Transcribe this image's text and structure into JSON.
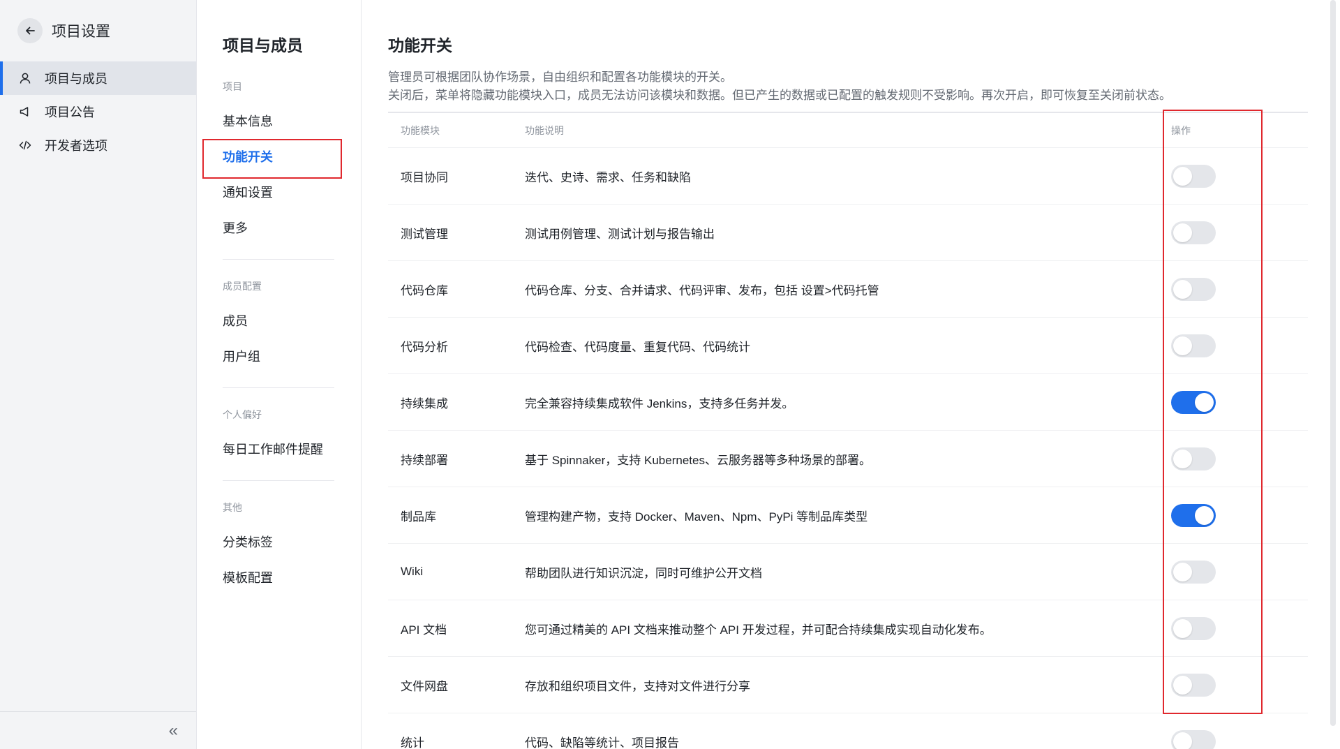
{
  "sidebar": {
    "title": "项目设置",
    "items": [
      {
        "label": "项目与成员",
        "icon": "user-icon",
        "active": true
      },
      {
        "label": "项目公告",
        "icon": "megaphone-icon",
        "active": false
      },
      {
        "label": "开发者选项",
        "icon": "code-icon",
        "active": false
      }
    ],
    "collapse_label": "«"
  },
  "subnav": {
    "title": "项目与成员",
    "groups": [
      {
        "label": "项目",
        "items": [
          "基本信息",
          "功能开关",
          "通知设置",
          "更多"
        ]
      },
      {
        "label": "成员配置",
        "items": [
          "成员",
          "用户组"
        ]
      },
      {
        "label": "个人偏好",
        "items": [
          "每日工作邮件提醒"
        ]
      },
      {
        "label": "其他",
        "items": [
          "分类标签",
          "模板配置"
        ]
      }
    ],
    "active_item": "功能开关"
  },
  "main": {
    "title": "功能开关",
    "desc_lines": [
      "管理员可根据团队协作场景，自由组织和配置各功能模块的开关。",
      "关闭后，菜单将隐藏功能模块入口，成员无法访问该模块和数据。但已产生的数据或已配置的触发规则不受影响。再次开启，即可恢复至关闭前状态。"
    ],
    "table": {
      "headers": {
        "module": "功能模块",
        "desc": "功能说明",
        "op": "操作"
      },
      "rows": [
        {
          "module": "项目协同",
          "desc": "迭代、史诗、需求、任务和缺陷",
          "on": false
        },
        {
          "module": "测试管理",
          "desc": "测试用例管理、测试计划与报告输出",
          "on": false
        },
        {
          "module": "代码仓库",
          "desc": "代码仓库、分支、合并请求、代码评审、发布，包括 设置>代码托管",
          "on": false
        },
        {
          "module": "代码分析",
          "desc": "代码检查、代码度量、重复代码、代码统计",
          "on": false
        },
        {
          "module": "持续集成",
          "desc": "完全兼容持续集成软件 Jenkins，支持多任务并发。",
          "on": true
        },
        {
          "module": "持续部署",
          "desc": "基于 Spinnaker，支持 Kubernetes、云服务器等多种场景的部署。",
          "on": false
        },
        {
          "module": "制品库",
          "desc": "管理构建产物，支持 Docker、Maven、Npm、PyPi 等制品库类型",
          "on": true
        },
        {
          "module": "Wiki",
          "desc": "帮助团队进行知识沉淀，同时可维护公开文档",
          "on": false
        },
        {
          "module": "API 文档",
          "desc": "您可通过精美的 API 文档来推动整个 API 开发过程，并可配合持续集成实现自动化发布。",
          "on": false
        },
        {
          "module": "文件网盘",
          "desc": "存放和组织项目文件，支持对文件进行分享",
          "on": false
        },
        {
          "module": "统计",
          "desc": "代码、缺陷等统计、项目报告",
          "on": false
        }
      ]
    }
  },
  "colors": {
    "accent": "#1f6feb",
    "highlight": "#e0282e",
    "sidebar_bg": "#f3f4f6"
  }
}
